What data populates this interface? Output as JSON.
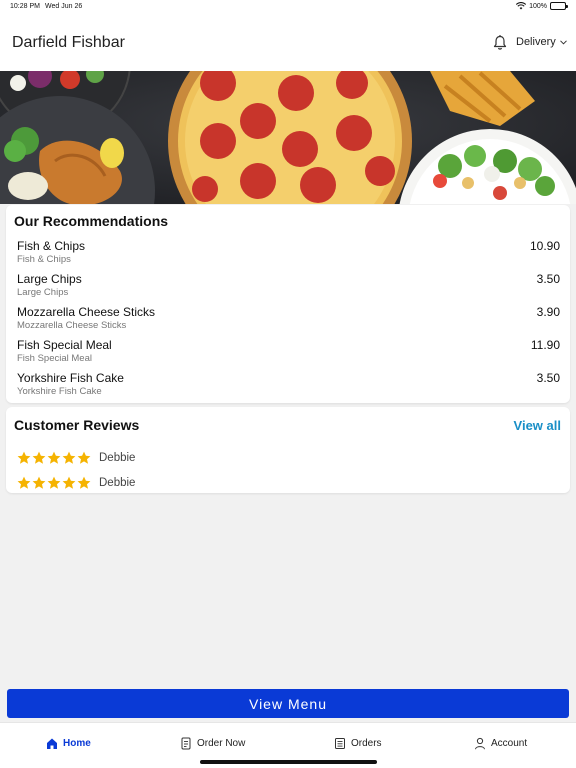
{
  "status_bar": {
    "time": "10:28 PM",
    "date": "Wed Jun 26",
    "battery": "100%"
  },
  "header": {
    "title": "Darfield Fishbar",
    "delivery_label": "Delivery"
  },
  "recommendations": {
    "title": "Our Recommendations",
    "items": [
      {
        "name": "Fish & Chips",
        "description": "Fish & Chips",
        "price": "10.90"
      },
      {
        "name": "Large Chips",
        "description": "Large Chips",
        "price": "3.50"
      },
      {
        "name": "Mozzarella Cheese Sticks",
        "description": "Mozzarella Cheese Sticks",
        "price": "3.90"
      },
      {
        "name": "Fish Special Meal",
        "description": "Fish Special Meal",
        "price": "11.90"
      },
      {
        "name": "Yorkshire Fish Cake",
        "description": "Yorkshire Fish Cake",
        "price": "3.50"
      }
    ]
  },
  "reviews": {
    "title": "Customer Reviews",
    "view_all_label": "View all",
    "items": [
      {
        "name": "Debbie",
        "rating": 5
      },
      {
        "name": "Debbie",
        "rating": 5
      }
    ]
  },
  "view_menu_label": "View Menu",
  "tabs": [
    {
      "label": "Home",
      "icon": "home-icon",
      "active": true
    },
    {
      "label": "Order Now",
      "icon": "order-icon",
      "active": false
    },
    {
      "label": "Orders",
      "icon": "orders-icon",
      "active": false
    },
    {
      "label": "Account",
      "icon": "account-icon",
      "active": false
    }
  ],
  "colors": {
    "accent": "#0a3ad6",
    "link": "#1a8fc7",
    "star": "#f5b301",
    "background": "#f1f1f1"
  }
}
